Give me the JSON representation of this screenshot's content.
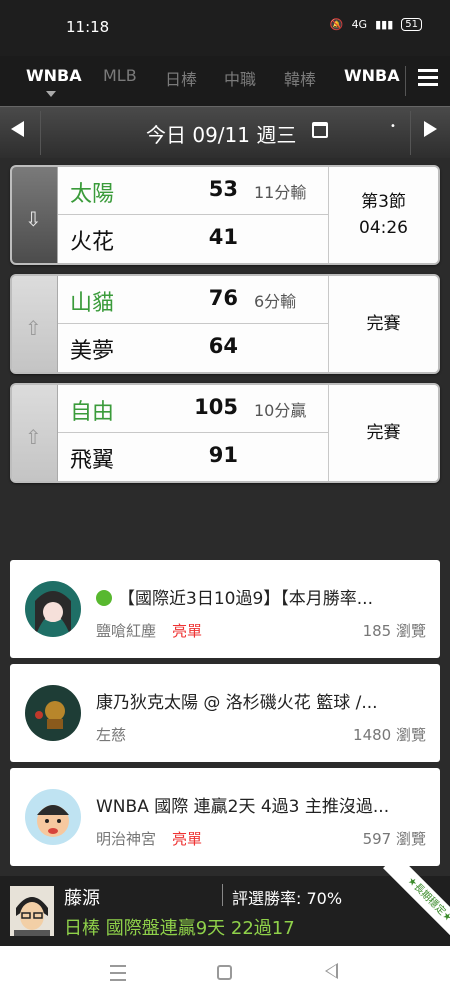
{
  "status_bar": {
    "time": "11:18",
    "icons": [
      "mute-icon",
      "volte-icon",
      "signal-icon"
    ],
    "network": "4G",
    "battery": "51"
  },
  "tabs": [
    {
      "label": "WNBA",
      "active": true
    },
    {
      "label": "MLB",
      "active": false
    },
    {
      "label": "日棒",
      "active": false
    },
    {
      "label": "中職",
      "active": false
    },
    {
      "label": "韓棒",
      "active": false
    },
    {
      "label": "WNBA",
      "active": false
    }
  ],
  "date_bar": {
    "label": "今日 09/11 週三"
  },
  "games": [
    {
      "expanded": true,
      "home": {
        "name": "太陽",
        "score": "53",
        "diff": "11分輸"
      },
      "away": {
        "name": "火花",
        "score": "41"
      },
      "status_line1": "第3節",
      "status_line2": "04:26"
    },
    {
      "expanded": false,
      "home": {
        "name": "山貓",
        "score": "76",
        "diff": "6分輸"
      },
      "away": {
        "name": "美夢",
        "score": "64"
      },
      "status_line1": "完賽",
      "status_line2": ""
    },
    {
      "expanded": false,
      "home": {
        "name": "自由",
        "score": "105",
        "diff": "10分贏"
      },
      "away": {
        "name": "飛翼",
        "score": "91"
      },
      "status_line1": "完賽",
      "status_line2": ""
    }
  ],
  "posts": [
    {
      "title": "【國際近3日10過9】【本月勝率...",
      "author": "鹽嗆紅塵",
      "tag": "亮單",
      "views": "185 瀏覽"
    },
    {
      "title": "康乃狄克太陽 @ 洛杉磯火花 籃球 /...",
      "author": "左慈",
      "tag": "",
      "views": "1480 瀏覽"
    },
    {
      "title": "WNBA 國際 連贏2天 4過3 主推沒過...",
      "author": "明治神宮",
      "tag": "亮單",
      "views": "597 瀏覽"
    }
  ],
  "banner": {
    "name": "藤源",
    "rate": "評選勝率: 70%",
    "headline": "日棒 國際盤連贏9天 22過17",
    "ribbon": "★長期穩定★"
  },
  "colors": {
    "accent_green": "#3a9b3a",
    "tag_red": "#e33333",
    "banner_green": "#8fd14a"
  }
}
